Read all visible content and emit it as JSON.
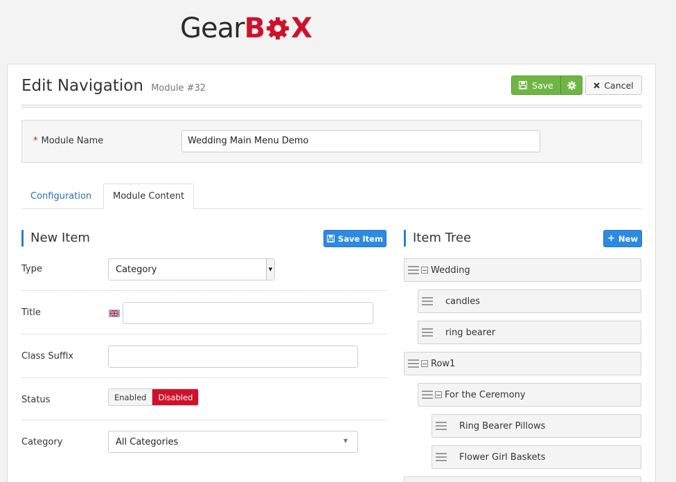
{
  "logo": {
    "gear": "Gear",
    "b": "B",
    "x": "X"
  },
  "header": {
    "title": "Edit Navigation",
    "subtitle": "Module #32",
    "save_label": "Save",
    "cancel_label": "Cancel"
  },
  "module": {
    "required_mark": "*",
    "name_label": "Module Name",
    "name_value": "Wedding Main Menu Demo"
  },
  "tabs": [
    {
      "label": "Configuration",
      "active": false
    },
    {
      "label": "Module Content",
      "active": true
    }
  ],
  "new_item": {
    "heading": "New Item",
    "save_item_label": "Save Item",
    "type_label": "Type",
    "type_value": "Category",
    "title_label": "Title",
    "title_value": "",
    "class_suffix_label": "Class Suffix",
    "class_suffix_value": "",
    "status_label": "Status",
    "status_enabled": "Enabled",
    "status_disabled": "Disabled",
    "category_label": "Category",
    "category_value": "All Categories"
  },
  "item_tree": {
    "heading": "Item Tree",
    "new_label": "New",
    "items": [
      {
        "label": "Wedding",
        "level": 0,
        "collapsible": true
      },
      {
        "label": "candles",
        "level": 1,
        "collapsible": false
      },
      {
        "label": "ring bearer",
        "level": 1,
        "collapsible": false
      },
      {
        "label": "Row1",
        "level": 0,
        "collapsible": true
      },
      {
        "label": "For the Ceremony",
        "level": 1,
        "collapsible": true
      },
      {
        "label": "Ring Bearer Pillows",
        "level": 2,
        "collapsible": false
      },
      {
        "label": "Flower Girl Baskets",
        "level": 2,
        "collapsible": false
      }
    ]
  },
  "colors": {
    "brand_red": "#d0112b",
    "save_green": "#6fb543",
    "accent_blue": "#2d8ae0",
    "link_blue": "#2a6db6"
  }
}
